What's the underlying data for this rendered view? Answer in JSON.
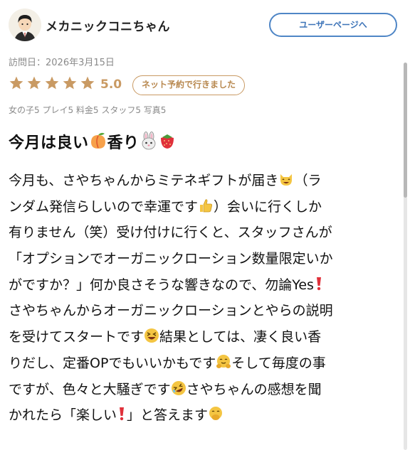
{
  "profile": {
    "username": "メカニックコニちゃん",
    "user_page_button": "ユーザーページへ"
  },
  "visit": {
    "label": "訪問日：2026年3月15日"
  },
  "rating": {
    "stars": 5,
    "score": "5.0",
    "badge": "ネット予約で行きました",
    "star_color": "#c99a63"
  },
  "subscores": "女の子5 プレイ5 料金5 スタッフ5 写真5",
  "review": {
    "title_parts": [
      "今月は良い",
      "香り"
    ],
    "title_emojis": [
      "peach-emoji",
      "rabbit-emoji",
      "strawberry-emoji"
    ],
    "lines": [
      [
        "今月も、さやちゃんからミテネギフトが届き",
        "（ラ"
      ],
      [
        "ンダム発信らしいので幸運です",
        "）会いに行くしか"
      ],
      [
        "有りません（笑）受け付けに行くと、スタッフさんが"
      ],
      [
        "「オプションでオーガニックローション数量限定いか"
      ],
      [
        "がですか？」何か良さそうな響きなので、勿論Yes"
      ],
      [
        "さやちゃんからオーガニックローションとやらの説明"
      ],
      [
        "を受けてスタートです",
        "結果としては、凄く良い香"
      ],
      [
        "りだし、定番OPでもいいかもです",
        "そして毎度の事"
      ],
      [
        "ですが、色々と大騒ぎです",
        "さやちゃんの感想を聞"
      ],
      [
        "かれたら「楽しい",
        "」と答えます"
      ]
    ]
  }
}
